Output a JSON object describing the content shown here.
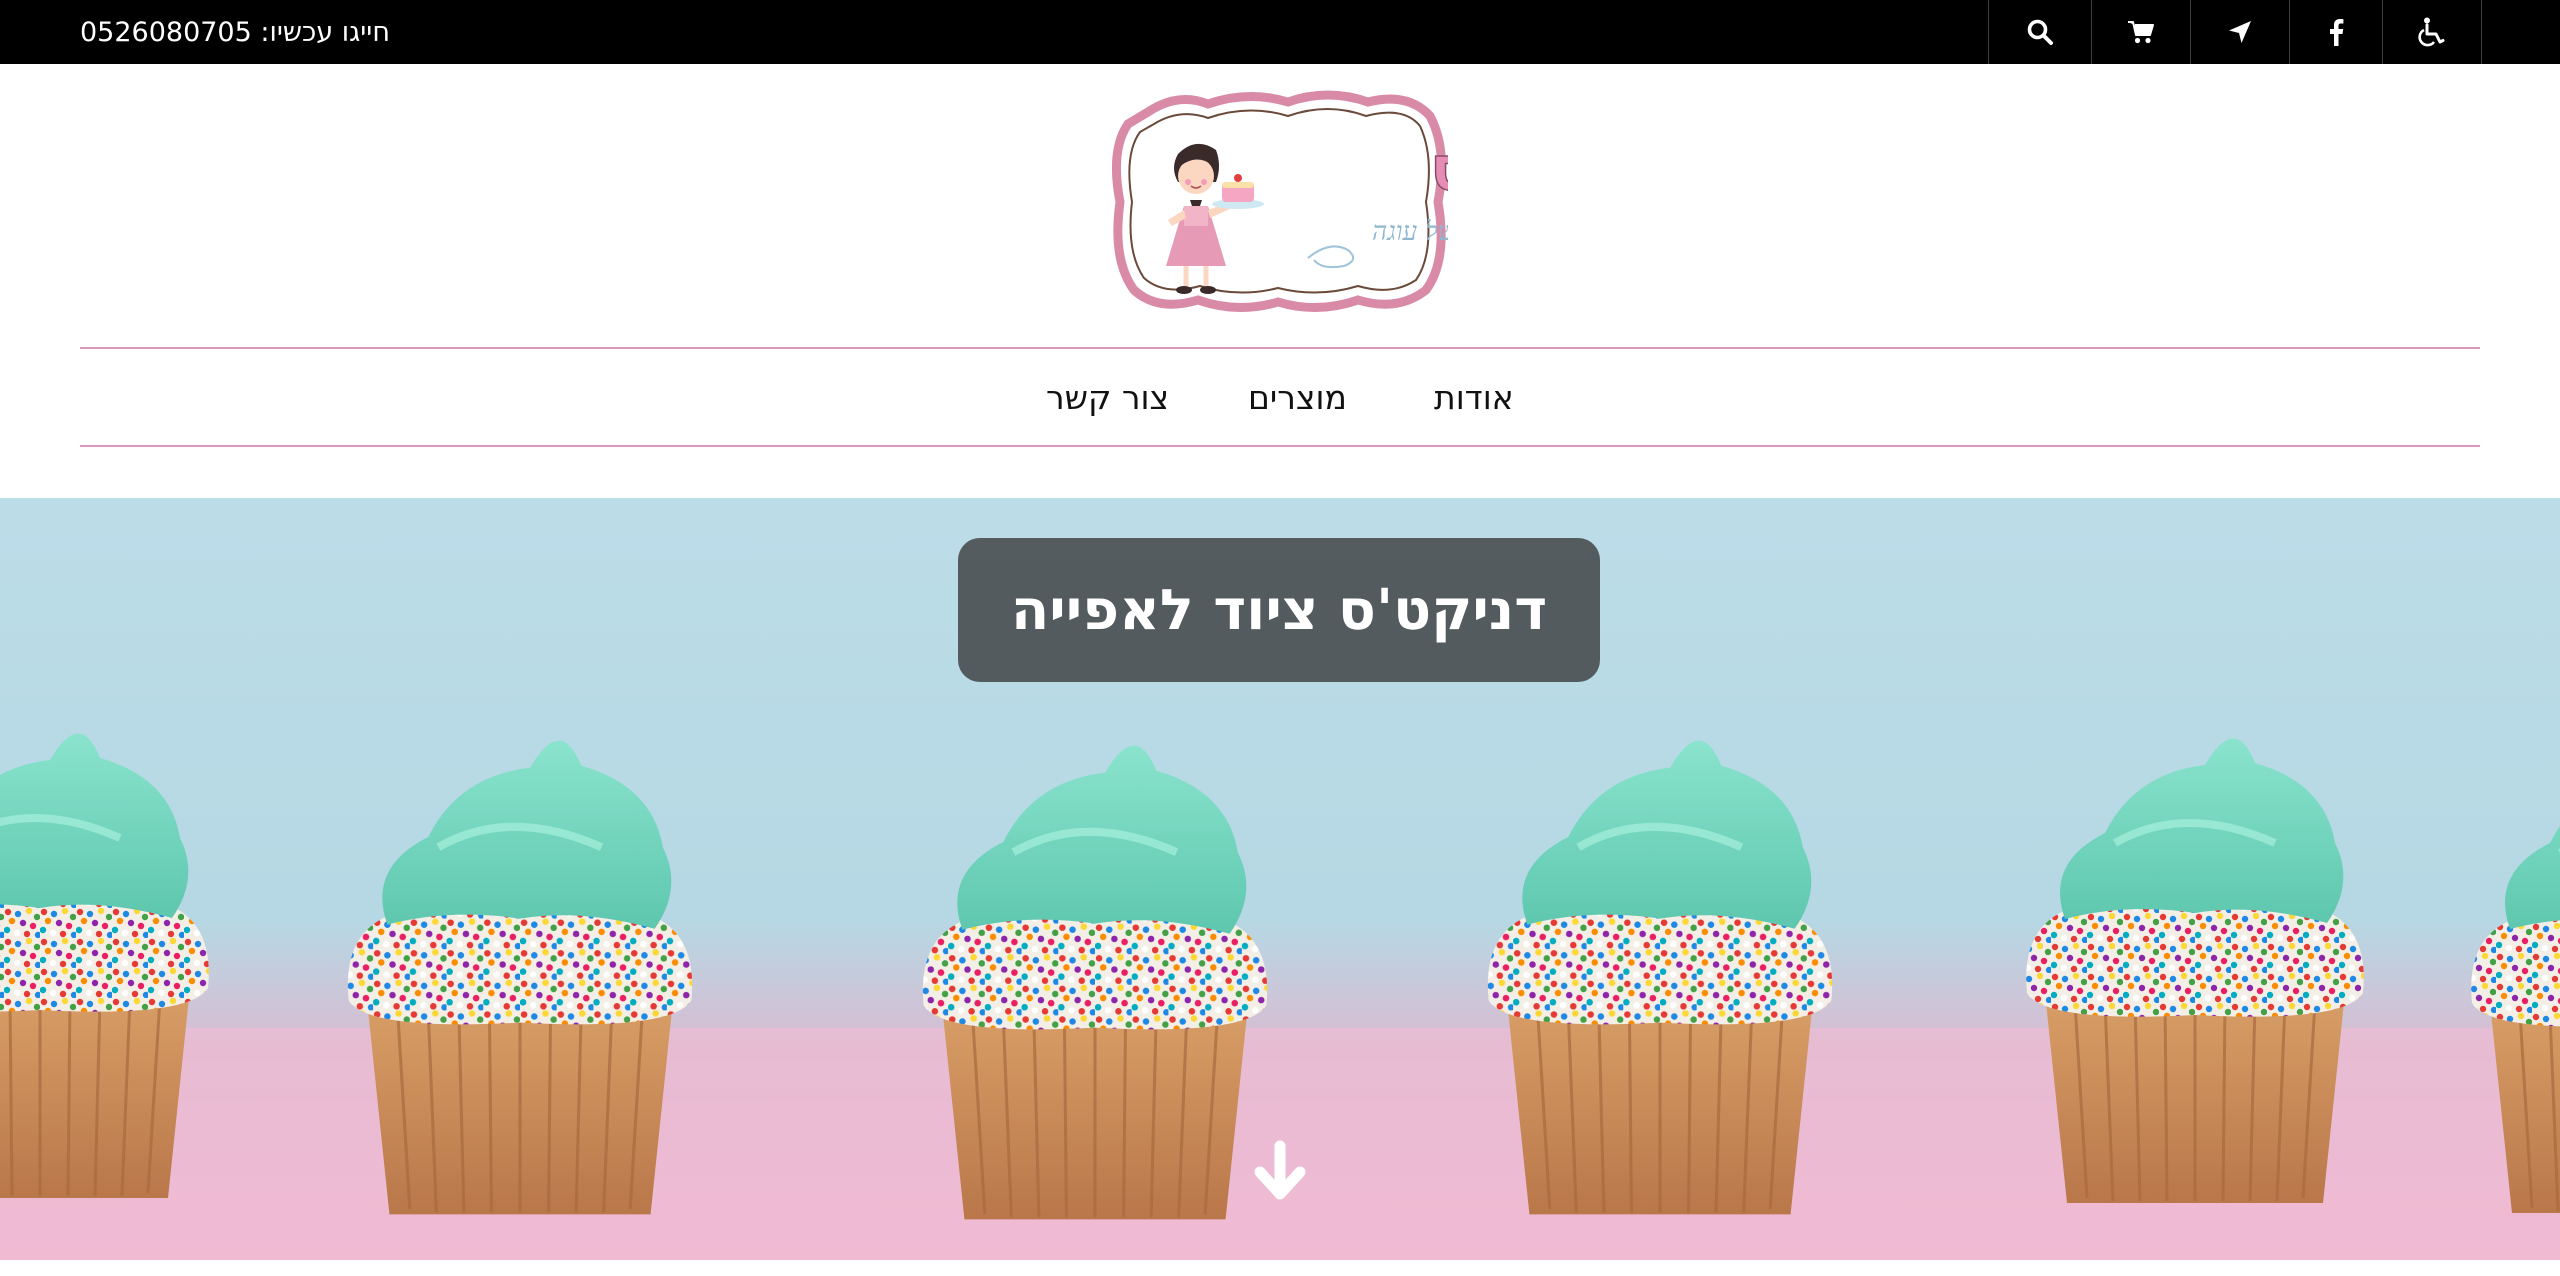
{
  "topbar": {
    "call_label": "חייגו עכשיו:",
    "phone": "0526080705",
    "icons": [
      "search-icon",
      "cart-icon",
      "location-arrow-icon",
      "facebook-icon",
      "accessibility-icon"
    ]
  },
  "logo": {
    "brand_name": "דניקט'ס",
    "tagline": "יופי של עוגה"
  },
  "nav": {
    "items": [
      {
        "label": "אודות"
      },
      {
        "label": "מוצרים"
      },
      {
        "label": "צור קשר"
      }
    ]
  },
  "hero": {
    "title": "דניקט'ס ציוד לאפייה",
    "scroll_icon": "arrow-down-icon"
  },
  "colors": {
    "topbar_bg": "#000000",
    "accent_pink": "#dc98c2",
    "frosting": "#7fd9c3"
  }
}
